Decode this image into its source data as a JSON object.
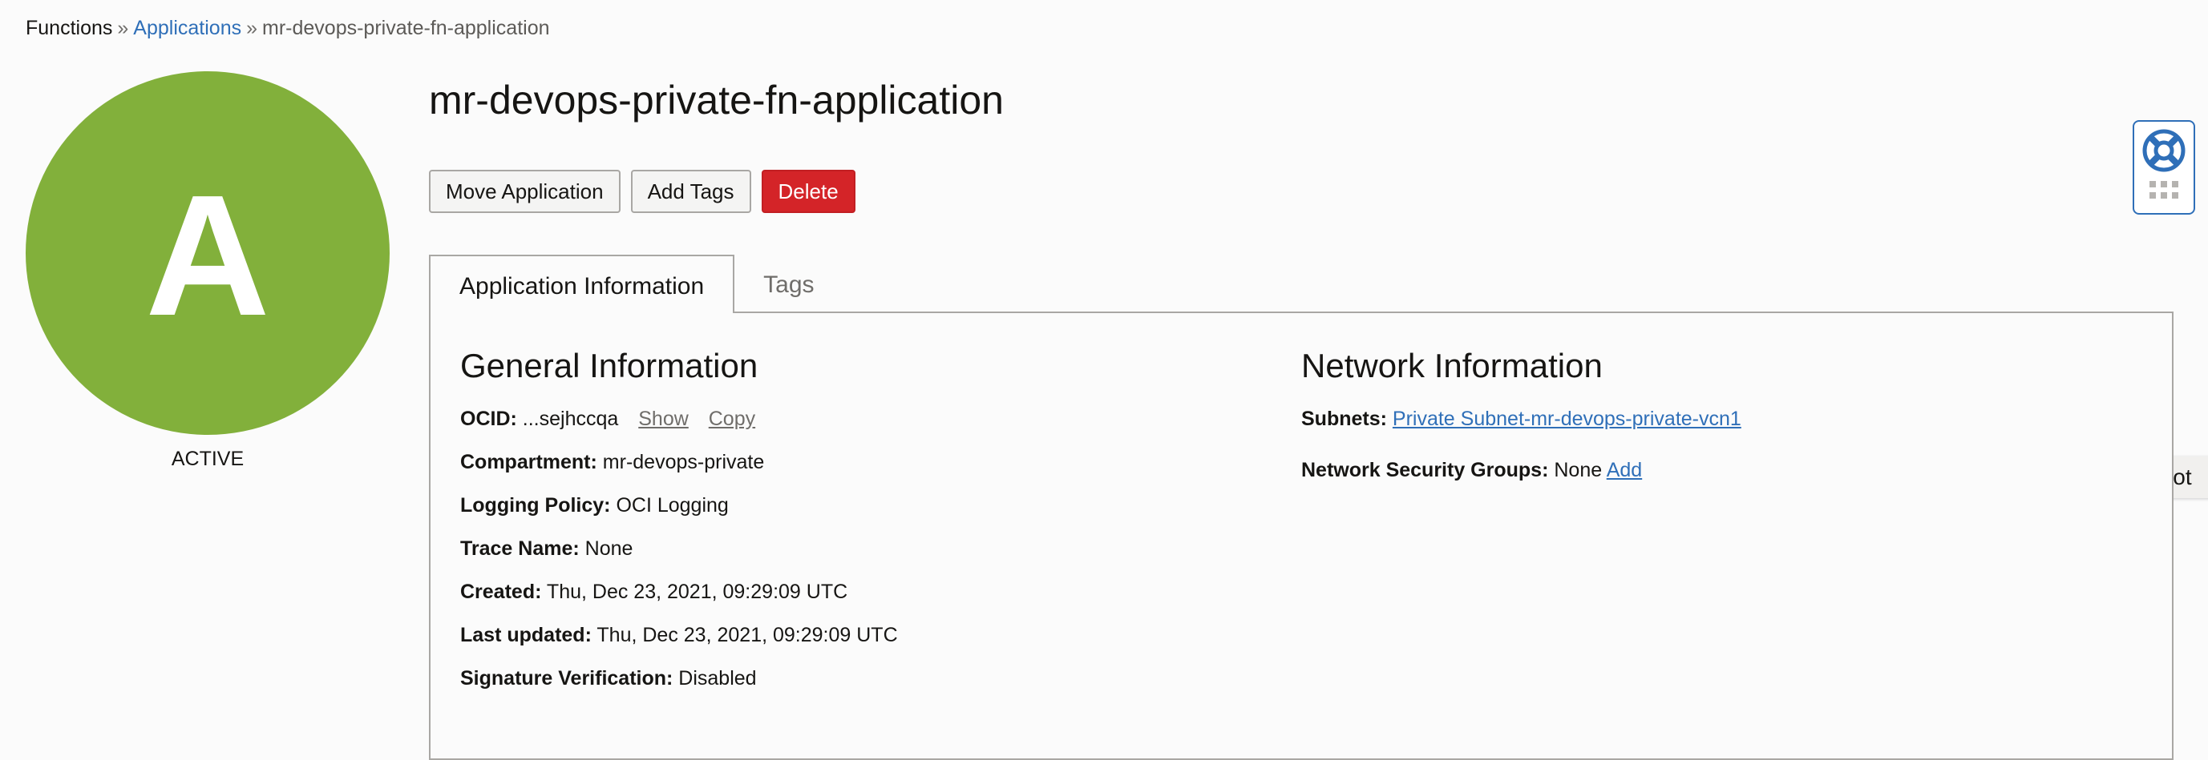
{
  "breadcrumb": {
    "root": "Functions",
    "separator": "»",
    "parent": "Applications",
    "current": "mr-devops-private-fn-application"
  },
  "avatar": {
    "letter": "A",
    "status": "ACTIVE",
    "color": "#82b03b"
  },
  "page_title": "mr-devops-private-fn-application",
  "actions": {
    "move": "Move Application",
    "add_tags": "Add Tags",
    "delete": "Delete"
  },
  "tabs": [
    {
      "label": "Application Information",
      "active": true
    },
    {
      "label": "Tags",
      "active": false
    }
  ],
  "general": {
    "title": "General Information",
    "ocid_label": "OCID:",
    "ocid_value": "...sejhccqa",
    "ocid_show": "Show",
    "ocid_copy": "Copy",
    "compartment_label": "Compartment:",
    "compartment_value": "mr-devops-private",
    "logging_label": "Logging Policy:",
    "logging_value": "OCI Logging",
    "trace_label": "Trace Name:",
    "trace_value": "None",
    "created_label": "Created:",
    "created_value": "Thu, Dec 23, 2021, 09:29:09 UTC",
    "updated_label": "Last updated:",
    "updated_value": "Thu, Dec 23, 2021, 09:29:09 UTC",
    "signature_label": "Signature Verification:",
    "signature_value": "Disabled"
  },
  "network": {
    "title": "Network Information",
    "subnets_label": "Subnets:",
    "subnets_value": "Private Subnet-mr-devops-private-vcn1",
    "nsg_label": "Network Security Groups:",
    "nsg_value": "None",
    "nsg_add": "Add"
  },
  "widgets": {
    "help_icon": "lifebuoy-icon",
    "screenshot": "Screenshot"
  },
  "colors": {
    "link": "#2f6fb8",
    "danger": "#d42428",
    "avatar": "#82b03b"
  }
}
